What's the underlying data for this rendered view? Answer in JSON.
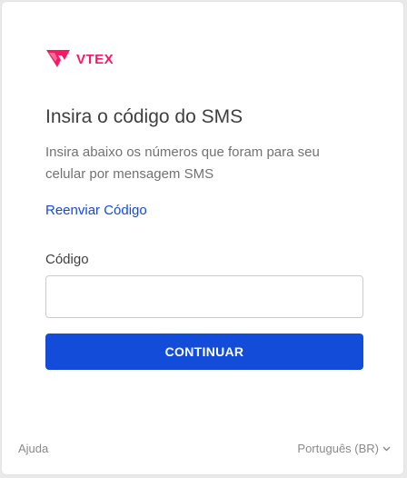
{
  "logo": {
    "text": "VTEX"
  },
  "login": {
    "title": "Insira o código do SMS",
    "subtitle": "Insira abaixo os números que foram para seu celular por mensagem SMS",
    "resend_label": "Reenviar Código",
    "code_label": "Código",
    "code_value": "",
    "code_placeholder": "",
    "continue_label": "CONTINUAR"
  },
  "footer": {
    "help_label": "Ajuda",
    "language_label": "Português (BR)"
  },
  "colors": {
    "brand_pink": "#f71963",
    "primary_blue": "#134cd8",
    "title_text": "#3f3f40",
    "muted_text": "#727273"
  },
  "icons": {
    "logo": "vtex-logo-icon",
    "language_dropdown": "chevron-down-icon"
  }
}
